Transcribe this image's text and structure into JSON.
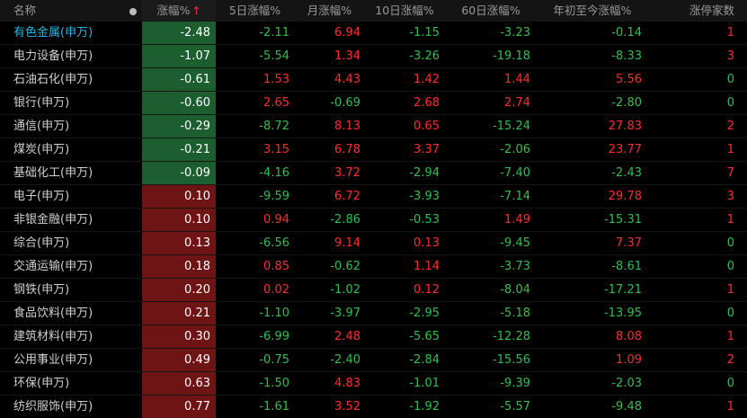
{
  "header": {
    "name": "名称",
    "chg": "涨幅%",
    "sort_arrow": "↑",
    "chg_5d": "5日涨幅%",
    "chg_month": "月涨幅%",
    "chg_10d": "10日涨幅%",
    "chg_60d": "60日涨幅%",
    "chg_ytd": "年初至今涨幅%",
    "limit_up": "涨停家数"
  },
  "colors": {
    "up": "#ff2d2d",
    "down": "#2ec04e",
    "neg_bg": "#1d5e30",
    "pos_bg": "#6e1414",
    "highlight": "#28b6e0"
  },
  "rows": [
    {
      "name": "有色金属(申万)",
      "chg": "-2.48",
      "d5": "-2.11",
      "mo": "6.94",
      "d10": "-1.15",
      "d60": "-3.23",
      "ytd": "-0.14",
      "lim": "1"
    },
    {
      "name": "电力设备(申万)",
      "chg": "-1.07",
      "d5": "-5.54",
      "mo": "1.34",
      "d10": "-3.26",
      "d60": "-19.18",
      "ytd": "-8.33",
      "lim": "3"
    },
    {
      "name": "石油石化(申万)",
      "chg": "-0.61",
      "d5": "1.53",
      "mo": "4.43",
      "d10": "1.42",
      "d60": "1.44",
      "ytd": "5.56",
      "lim": "0"
    },
    {
      "name": "银行(申万)",
      "chg": "-0.60",
      "d5": "2.65",
      "mo": "-0.69",
      "d10": "2.68",
      "d60": "2.74",
      "ytd": "-2.80",
      "lim": "0"
    },
    {
      "name": "通信(申万)",
      "chg": "-0.29",
      "d5": "-8.72",
      "mo": "8.13",
      "d10": "0.65",
      "d60": "-15.24",
      "ytd": "27.83",
      "lim": "2"
    },
    {
      "name": "煤炭(申万)",
      "chg": "-0.21",
      "d5": "3.15",
      "mo": "6.78",
      "d10": "3.37",
      "d60": "-2.06",
      "ytd": "23.77",
      "lim": "1"
    },
    {
      "name": "基础化工(申万)",
      "chg": "-0.09",
      "d5": "-4.16",
      "mo": "3.72",
      "d10": "-2.94",
      "d60": "-7.40",
      "ytd": "-2.43",
      "lim": "7"
    },
    {
      "name": "电子(申万)",
      "chg": "0.10",
      "d5": "-9.59",
      "mo": "6.72",
      "d10": "-3.93",
      "d60": "-7.14",
      "ytd": "29.78",
      "lim": "3"
    },
    {
      "name": "非银金融(申万)",
      "chg": "0.10",
      "d5": "0.94",
      "mo": "-2.86",
      "d10": "-0.53",
      "d60": "1.49",
      "ytd": "-15.31",
      "lim": "1"
    },
    {
      "name": "综合(申万)",
      "chg": "0.13",
      "d5": "-6.56",
      "mo": "9.14",
      "d10": "0.13",
      "d60": "-9.45",
      "ytd": "7.37",
      "lim": "0"
    },
    {
      "name": "交通运输(申万)",
      "chg": "0.18",
      "d5": "0.85",
      "mo": "-0.62",
      "d10": "1.14",
      "d60": "-3.73",
      "ytd": "-8.61",
      "lim": "0"
    },
    {
      "name": "钢铁(申万)",
      "chg": "0.20",
      "d5": "0.02",
      "mo": "-1.02",
      "d10": "0.12",
      "d60": "-8.04",
      "ytd": "-17.21",
      "lim": "1"
    },
    {
      "name": "食品饮料(申万)",
      "chg": "0.21",
      "d5": "-1.10",
      "mo": "-3.97",
      "d10": "-2.95",
      "d60": "-5.18",
      "ytd": "-13.95",
      "lim": "0"
    },
    {
      "name": "建筑材料(申万)",
      "chg": "0.30",
      "d5": "-6.99",
      "mo": "2.48",
      "d10": "-5.65",
      "d60": "-12.28",
      "ytd": "8.08",
      "lim": "1"
    },
    {
      "name": "公用事业(申万)",
      "chg": "0.49",
      "d5": "-0.75",
      "mo": "-2.40",
      "d10": "-2.84",
      "d60": "-15.56",
      "ytd": "1.09",
      "lim": "2"
    },
    {
      "name": "环保(申万)",
      "chg": "0.63",
      "d5": "-1.50",
      "mo": "4.83",
      "d10": "-1.01",
      "d60": "-9.39",
      "ytd": "-2.03",
      "lim": "0"
    },
    {
      "name": "纺织服饰(申万)",
      "chg": "0.77",
      "d5": "-1.61",
      "mo": "3.52",
      "d10": "-1.92",
      "d60": "-5.57",
      "ytd": "-9.48",
      "lim": "1"
    }
  ]
}
